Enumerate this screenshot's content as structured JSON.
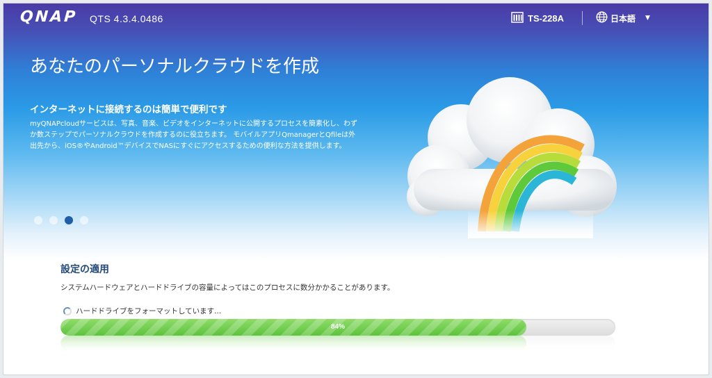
{
  "header": {
    "logo": "QNAP",
    "version": "QTS 4.3.4.0486",
    "device_name": "TS-228A",
    "language": "日本語"
  },
  "hero": {
    "title": "あなたのパーソナルクラウドを作成",
    "subtitle": "インターネットに接続するのは簡単で便利です",
    "description": "myQNAPcloudサービスは、写真、音楽、ビデオをインターネットに公開するプロセスを簡素化し、わずか数ステップでパーソナルクラウドを作成するのに役立ちます。 モバイルアプリQmanagerとQfileは外出先から、iOS®やAndroid™デバイスでNASにすぐにアクセスするための便利な方法を提供します。",
    "slides": 4,
    "active_slide": 3
  },
  "setup": {
    "title": "設定の適用",
    "description": "システムハードウェアとハードドライブの容量によってはこのプロセスに数分かかることがあります。",
    "status": "ハードドライブをフォーマットしています...",
    "progress_label": "84%",
    "progress_value": 0.84
  },
  "colors": {
    "accent": "#1f5fa8",
    "progress": "#5cc33b",
    "section_title": "#244a79"
  },
  "icons": {
    "device": "nas-device-icon",
    "language": "globe-icon",
    "dropdown": "chevron-down-icon",
    "status": "spinner-icon"
  }
}
